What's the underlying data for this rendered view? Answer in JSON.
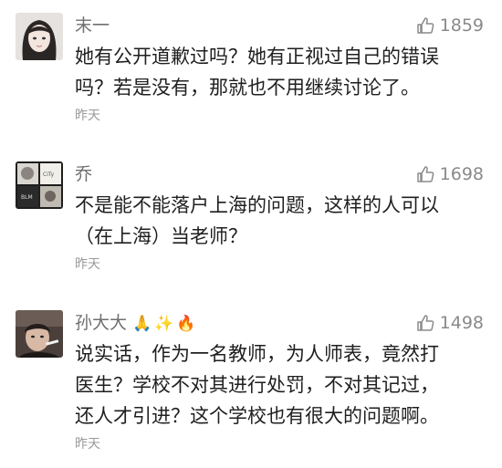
{
  "comments": [
    {
      "username": "末一",
      "likes": "1859",
      "text_lines": [
        "她有公开道歉过吗？她有正视过自己的错误",
        "吗？若是没有，那就也不用继续讨论了。"
      ],
      "time": "昨天",
      "avatar": "photo-avatar-girl"
    },
    {
      "username": "乔",
      "likes": "1698",
      "text_lines": [
        "不是能不能落户上海的问题，这样的人可以",
        "（在上海）当老师？"
      ],
      "time": "昨天",
      "avatar": "collage-avatar"
    },
    {
      "username": "孙大大",
      "badges": [
        "🙏",
        "✨",
        "🔥"
      ],
      "likes": "1498",
      "text_lines": [
        "说实话，作为一名教师，为人师表，竟然打",
        "医生？学校不对其进行处罚，不对其记过，",
        "还人才引进？这个学校也有很大的问题啊。"
      ],
      "time": "昨天",
      "avatar": "photo-avatar-man"
    }
  ],
  "colors": {
    "username": "#6f6f6f",
    "likes": "#8a8a8a",
    "text": "#1f1f1f",
    "time": "#9a9a9a"
  }
}
